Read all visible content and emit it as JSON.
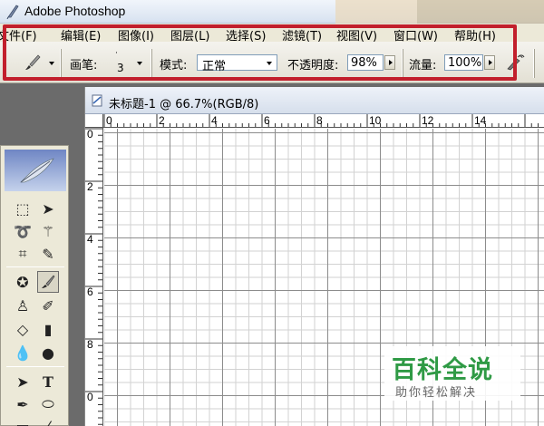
{
  "app": {
    "title": "Adobe Photoshop"
  },
  "menu": [
    "文件(F)",
    "编辑(E)",
    "图像(I)",
    "图层(L)",
    "选择(S)",
    "滤镜(T)",
    "视图(V)",
    "窗口(W)",
    "帮助(H)"
  ],
  "options": {
    "brush_label": "画笔:",
    "brush_size": "3",
    "mode_label": "模式:",
    "mode_value": "正常",
    "opacity_label": "不透明度:",
    "opacity_value": "98%",
    "flow_label": "流量:",
    "flow_value": "100%"
  },
  "document": {
    "title": "未标题-1 @ 66.7%(RGB/8)"
  },
  "rulers": {
    "horizontal": [
      "0",
      "2",
      "4",
      "6",
      "8",
      "10",
      "12",
      "14"
    ],
    "vertical": [
      "0",
      "2",
      "4",
      "6",
      "8",
      "0"
    ]
  },
  "watermark": {
    "title": "百科全说",
    "subtitle": "助你轻松解决"
  },
  "colors": {
    "highlight": "#c21f2c",
    "watermark_green": "#2f9a45"
  }
}
